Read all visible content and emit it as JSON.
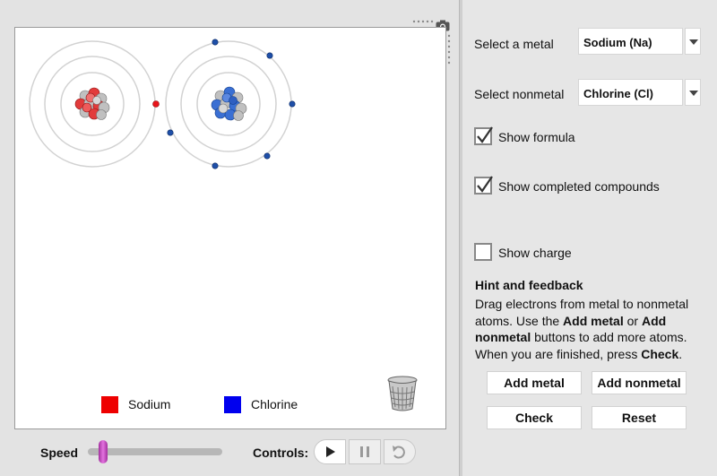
{
  "legend": {
    "items": [
      {
        "label": "Sodium",
        "color": "#ee0000"
      },
      {
        "label": "Chlorine",
        "color": "#0000ee"
      }
    ]
  },
  "panel": {
    "metal_label": "Select a metal",
    "metal_value": "Sodium (Na)",
    "nonmetal_label": "Select nonmetal",
    "nonmetal_value": "Chlorine (Cl)",
    "show_formula": {
      "label": "Show formula",
      "checked": true
    },
    "show_completed": {
      "label": "Show completed compounds",
      "checked": true
    },
    "show_charge": {
      "label": "Show charge",
      "checked": false
    },
    "hint_title": "Hint and feedback",
    "hint_parts": [
      "Drag electrons from metal to nonmetal atoms. Use the ",
      "Add metal",
      " or ",
      "Add nonmetal",
      " buttons to add more atoms. When you are finished, press ",
      "Check",
      "."
    ],
    "buttons": {
      "add_metal": "Add metal",
      "add_nonmetal": "Add nonmetal",
      "check": "Check",
      "reset": "Reset"
    }
  },
  "bottom": {
    "speed_label": "Speed",
    "controls_label": "Controls:",
    "speed_value_fraction": 0.1
  },
  "icons": {
    "camera": "camera-icon",
    "trash": "trash-icon",
    "play": "play-icon",
    "pause": "pause-icon",
    "reset": "undo-icon"
  },
  "colors": {
    "sodium": "#ee0000",
    "chlorine": "#0000ee",
    "electron_metal": "#e8141b",
    "electron_nonmetal": "#1e4fa8",
    "slider_thumb": "#c24cbe"
  }
}
